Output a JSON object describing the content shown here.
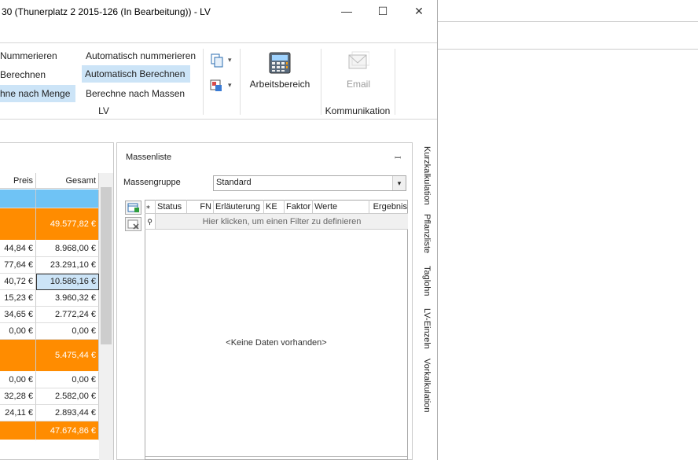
{
  "window": {
    "title": "30 (Thunerplatz 2 2015-126 (In Bearbeitung)) - LV",
    "minimize": "—",
    "maximize": "☐",
    "close": "✕"
  },
  "ribbon": {
    "left_items": [
      "Nummerieren",
      "Berechnen",
      "hne nach Menge"
    ],
    "lv_items": [
      "Automatisch nummerieren",
      "Automatisch Berechnen",
      "Berechne nach Massen"
    ],
    "lv_group": "LV",
    "arbeitsbereich": "Arbeitsbereich",
    "email": "Email",
    "kommunikation": "Kommunikation",
    "dropdown_arrow": "▾"
  },
  "grid": {
    "headers": [
      "Preis",
      "Gesamt"
    ],
    "rows": [
      {
        "preis": "",
        "gesamt": "",
        "style": "blue"
      },
      {
        "preis": "",
        "gesamt": "49.577,82 €",
        "style": "orange"
      },
      {
        "preis": "44,84 €",
        "gesamt": "8.968,00 €",
        "style": ""
      },
      {
        "preis": "77,64 €",
        "gesamt": "23.291,10 €",
        "style": ""
      },
      {
        "preis": "40,72 €",
        "gesamt": "10.586,16 €",
        "style": "selected"
      },
      {
        "preis": "15,23 €",
        "gesamt": "3.960,32 €",
        "style": ""
      },
      {
        "preis": "34,65 €",
        "gesamt": "2.772,24 €",
        "style": ""
      },
      {
        "preis": "0,00 €",
        "gesamt": "0,00 €",
        "style": ""
      },
      {
        "preis": "",
        "gesamt": "5.475,44 €",
        "style": "orange"
      },
      {
        "preis": "0,00 €",
        "gesamt": "0,00 €",
        "style": ""
      },
      {
        "preis": "32,28 €",
        "gesamt": "2.582,00 €",
        "style": ""
      },
      {
        "preis": "24,11 €",
        "gesamt": "2.893,44 €",
        "style": ""
      },
      {
        "preis": "",
        "gesamt": "47.674,86 €",
        "style": "orange"
      }
    ]
  },
  "massenliste": {
    "title": "Massenliste",
    "pin": "ꟷ",
    "gruppe_label": "Massengruppe",
    "gruppe_value": "Standard",
    "columns": [
      "Status",
      "FN",
      "Erläuterung",
      "KE",
      "Faktor",
      "Werte",
      "Ergebnis"
    ],
    "filter_hint": "Hier klicken, um einen Filter zu definieren",
    "empty_text": "<Keine Daten vorhanden>"
  },
  "side_tabs": [
    "Kurzkalkulation",
    "Pflanzliste",
    "Taglohn",
    "LV-Einzeln",
    "Vorkalkulation"
  ]
}
